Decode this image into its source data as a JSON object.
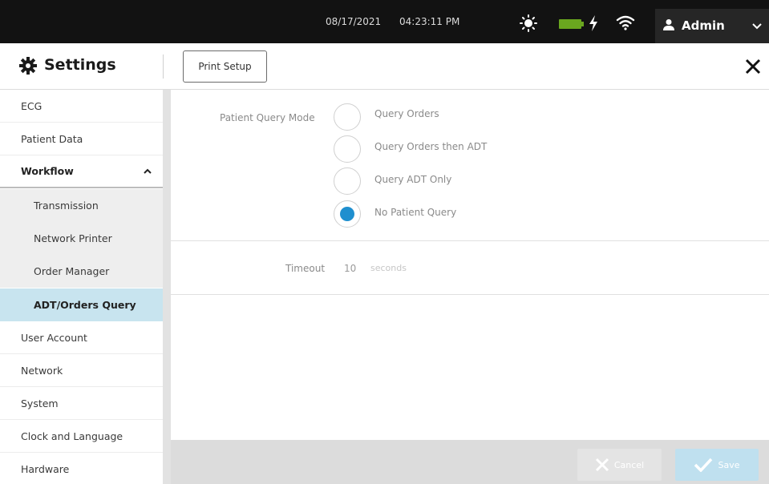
{
  "status_bar": {
    "date": "08/17/2021",
    "time": "04:23:11 PM",
    "battery_color": "#6aa61f",
    "user": "Admin"
  },
  "header": {
    "title": "Settings",
    "print_setup_label": "Print Setup"
  },
  "sidebar": {
    "items": [
      {
        "label": "ECG"
      },
      {
        "label": "Patient Data"
      },
      {
        "label": "Workflow"
      },
      {
        "label": "Transmission"
      },
      {
        "label": "Network Printer"
      },
      {
        "label": "Order Manager"
      },
      {
        "label": "ADT/Orders Query"
      },
      {
        "label": "User Account"
      },
      {
        "label": "Network"
      },
      {
        "label": "System"
      },
      {
        "label": "Clock and Language"
      },
      {
        "label": "Hardware"
      }
    ]
  },
  "main": {
    "patient_query_mode_label": "Patient Query Mode",
    "options": [
      {
        "label": "Query Orders",
        "selected": false
      },
      {
        "label": "Query Orders then ADT",
        "selected": false
      },
      {
        "label": "Query ADT Only",
        "selected": false
      },
      {
        "label": "No Patient Query",
        "selected": true
      }
    ],
    "timeout_label": "Timeout",
    "timeout_value": "10",
    "timeout_unit": "seconds"
  },
  "footer": {
    "cancel_label": "Cancel",
    "save_label": "Save"
  },
  "colors": {
    "accent": "#1f8fcf",
    "active_item_bg": "#c8e4ef"
  }
}
